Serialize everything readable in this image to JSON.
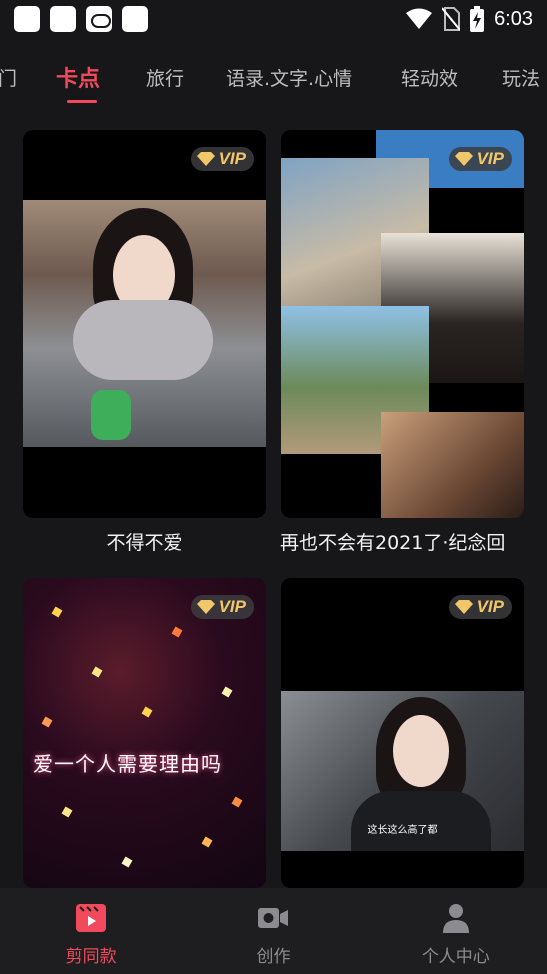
{
  "status_bar": {
    "time": "6:03",
    "icons": [
      "notification-square-icon",
      "notification-square-icon",
      "capcut-loop-icon",
      "notification-square-icon",
      "wifi-icon",
      "no-sim-icon",
      "battery-charging-icon"
    ]
  },
  "tabs": [
    {
      "label": "门"
    },
    {
      "label": "卡点"
    },
    {
      "label": "旅行"
    },
    {
      "label": "语录.文字.心情"
    },
    {
      "label": "轻动效"
    },
    {
      "label": "玩法"
    }
  ],
  "templates": [
    {
      "title": "不得不爱",
      "badge": "VIP"
    },
    {
      "title": "再也不会有2021了·纪念回",
      "badge": "VIP"
    },
    {
      "title": "",
      "badge": "VIP",
      "overlay_text": "爱一个人需要理由吗"
    },
    {
      "title": "",
      "badge": "VIP",
      "subtitle": "这长这么高了都"
    }
  ],
  "bottom_nav": [
    {
      "label": "剪同款",
      "icon": "clapperboard-icon",
      "active": true
    },
    {
      "label": "创作",
      "icon": "camera-icon",
      "active": false
    },
    {
      "label": "个人中心",
      "icon": "person-icon",
      "active": false
    }
  ],
  "colors": {
    "accent": "#f24a5c",
    "background": "#17171a",
    "vip_gold": "#f2c76a"
  }
}
